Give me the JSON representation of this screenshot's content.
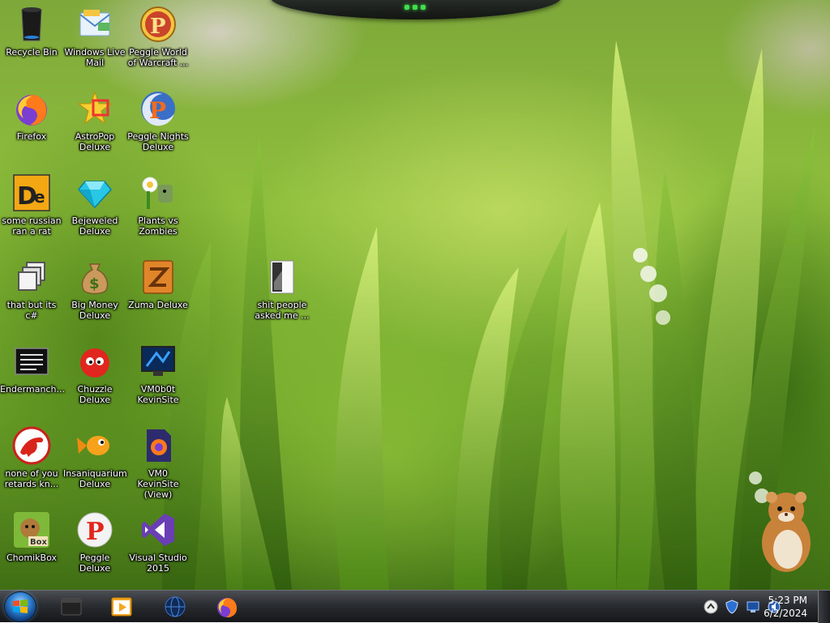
{
  "desktop": {
    "icons": [
      {
        "id": "recycle-bin",
        "label": "Recycle Bin",
        "icon": "recycle-bin-icon"
      },
      {
        "id": "windows-live-mail",
        "label": "Windows Live Mail",
        "icon": "mail-icon"
      },
      {
        "id": "peggle-world-of-warcraft",
        "label": "Peggle World of Warcraft ...",
        "icon": "peggle-icon"
      },
      {
        "id": "firefox",
        "label": "Firefox",
        "icon": "firefox-icon"
      },
      {
        "id": "astropop-deluxe",
        "label": "AstroPop Deluxe",
        "icon": "astropop-icon"
      },
      {
        "id": "peggle-nights-deluxe",
        "label": "Peggle Nights Deluxe",
        "icon": "peggle-nights-icon"
      },
      {
        "id": "some-russian-ran-a-rat",
        "label": "some russian ran a rat",
        "icon": "de-icon"
      },
      {
        "id": "bejeweled-deluxe",
        "label": "Bejeweled Deluxe",
        "icon": "diamond-icon"
      },
      {
        "id": "plants-vs-zombies",
        "label": "Plants vs Zombies",
        "icon": "plants-vs-zombies-icon"
      },
      {
        "id": "that-but-its-csharp",
        "label": "that but its c#",
        "icon": "windows-stack-icon"
      },
      {
        "id": "big-money-deluxe",
        "label": "Big Money Deluxe",
        "icon": "money-bag-icon"
      },
      {
        "id": "zuma-deluxe",
        "label": "Zuma Deluxe",
        "icon": "zuma-icon"
      },
      {
        "id": "shit-people-asked-me",
        "label": "shit people asked me ...",
        "icon": "folder-icon"
      },
      {
        "id": "endermanch",
        "label": "Endermanch...",
        "icon": "terminal-icon"
      },
      {
        "id": "chuzzle-deluxe",
        "label": "Chuzzle Deluxe",
        "icon": "chuzzle-icon"
      },
      {
        "id": "vm0b0t-kevinsite",
        "label": "VM0b0t KevinSite",
        "icon": "monitor-icon"
      },
      {
        "id": "none-of-you-retards",
        "label": "none of you retards kn...",
        "icon": "dino-icon"
      },
      {
        "id": "insaniquarium-deluxe",
        "label": "Insaniquarium Deluxe",
        "icon": "goldfish-icon"
      },
      {
        "id": "vm0-kevinsite-view",
        "label": "VM0 KevinSite (View)",
        "icon": "firefox-document-icon"
      },
      {
        "id": "chomikbox",
        "label": "ChomikBox",
        "icon": "chomikbox-icon"
      },
      {
        "id": "peggle-deluxe",
        "label": "Peggle Deluxe",
        "icon": "peggle-deluxe-icon"
      },
      {
        "id": "visual-studio-2015",
        "label": "Visual Studio 2015",
        "icon": "visual-studio-icon"
      }
    ]
  },
  "taskbar": {
    "start_button": "start-orb-icon",
    "pinned": [
      "terminal-window-icon",
      "media-player-icon",
      "globe-icon",
      "firefox-icon"
    ],
    "tray": [
      "show-hidden-icons-chevron",
      "security-shield-icon",
      "network-icon",
      "volume-icon"
    ],
    "clock": {
      "time": "5:23 PM",
      "date": "6/2/2024"
    }
  },
  "colors": {
    "accent": "#3fe04a",
    "taskbar": "#1e2124",
    "wallpaper_green": "#8fbf3c"
  }
}
